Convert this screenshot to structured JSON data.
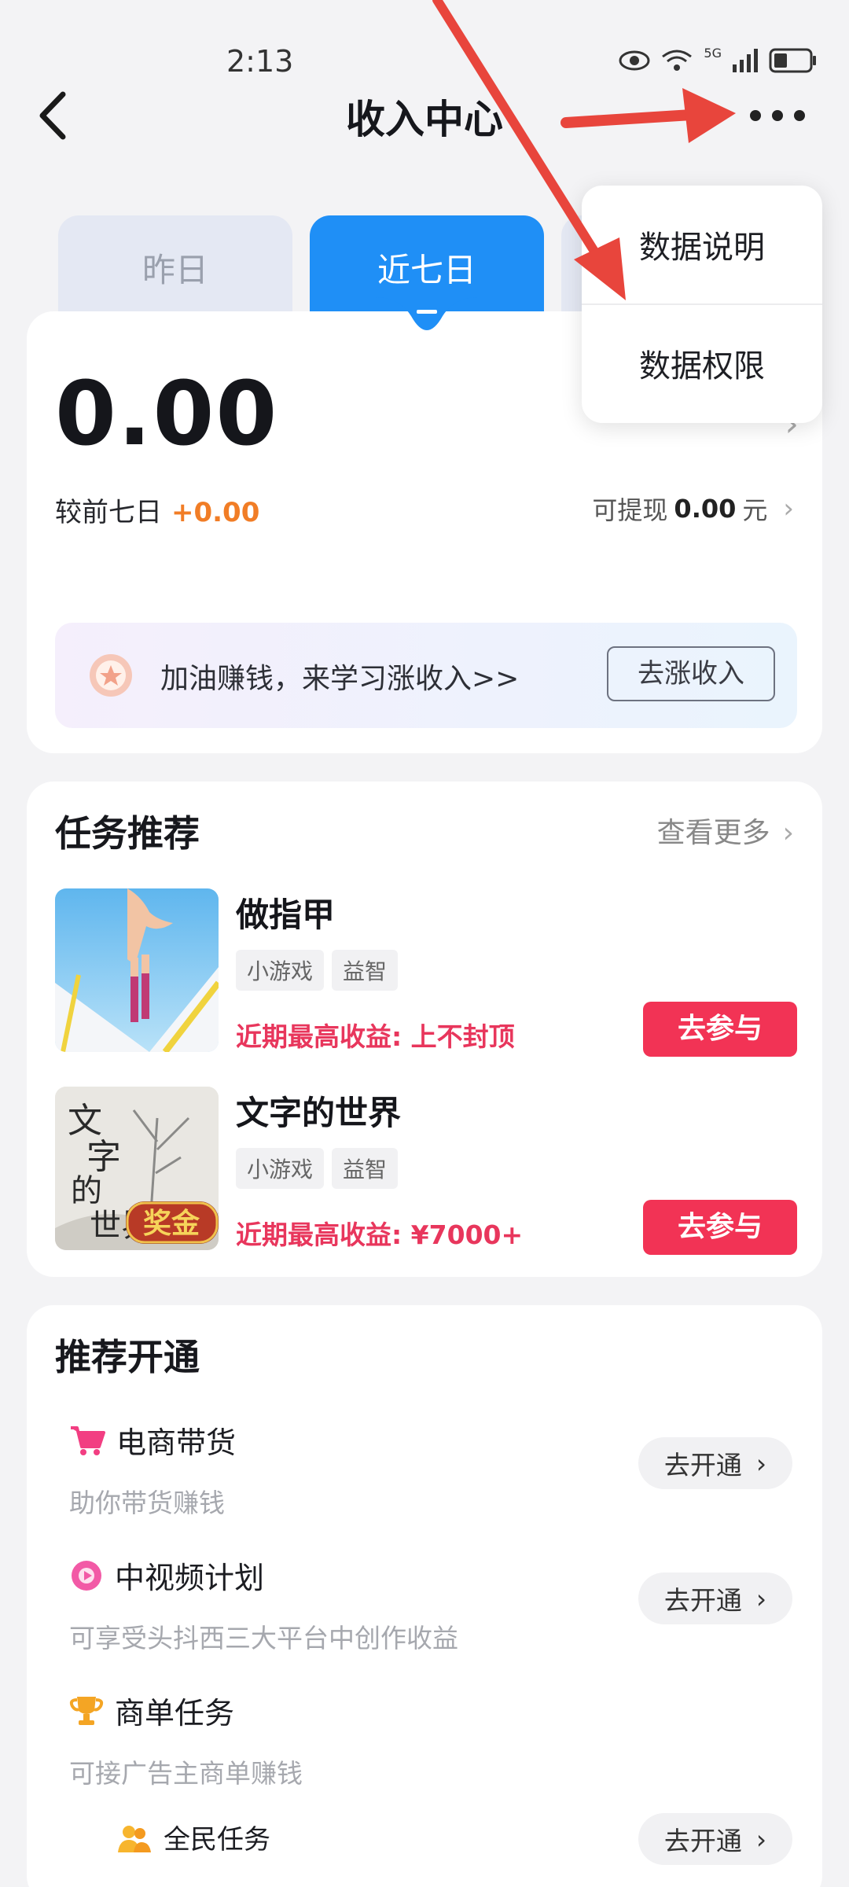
{
  "status_bar": {
    "time": "2:13",
    "network": "5G"
  },
  "nav": {
    "title": "收入中心"
  },
  "tabs": [
    {
      "label": "昨日",
      "active": false
    },
    {
      "label": "近七日",
      "active": true
    }
  ],
  "earnings": {
    "amount": "0.00",
    "compare_label": "较前七日",
    "compare_value": "+0.00",
    "withdraw_label": "可提现",
    "withdraw_amount": "0.00",
    "withdraw_unit": "元"
  },
  "promo": {
    "text": "加油赚钱，来学习涨收入>>",
    "button": "去涨收入"
  },
  "dropdown": {
    "items": [
      "数据说明",
      "数据权限"
    ]
  },
  "tasks": {
    "title": "任务推荐",
    "see_more": "查看更多",
    "items": [
      {
        "name": "做指甲",
        "tags": [
          "小游戏",
          "益智"
        ],
        "earning": "近期最高收益: 上不封顶",
        "button": "去参与"
      },
      {
        "name": "文字的世界",
        "tags": [
          "小游戏",
          "益智"
        ],
        "earning": "近期最高收益: ¥7000+",
        "button": "去参与",
        "thumb_text": "文字的世界",
        "thumb_badge": "奖金"
      }
    ]
  },
  "recommend": {
    "title": "推荐开通",
    "items": [
      {
        "title": "电商带货",
        "subtitle": "助你带货赚钱",
        "button": "去开通",
        "icon": "shopping-cart-icon"
      },
      {
        "title": "中视频计划",
        "subtitle": "可享受头抖西三大平台中创作收益",
        "button": "去开通",
        "icon": "video-plan-icon"
      },
      {
        "title": "商单任务",
        "subtitle": "可接广告主商单赚钱",
        "icon": "trophy-icon"
      },
      {
        "title": "全民任务",
        "button": "去开通",
        "icon": "people-task-icon"
      }
    ]
  },
  "colors": {
    "accent": "#1f8ff6",
    "orange": "#f17d26",
    "red": "#f23355",
    "annotation": "#e8453c"
  }
}
